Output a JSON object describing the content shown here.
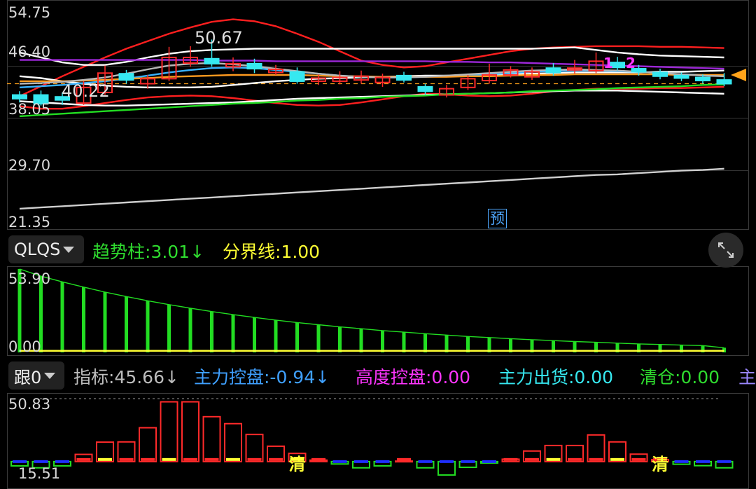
{
  "main_chart": {
    "price_labels": [
      "54.75",
      "46.40",
      "38.05",
      "29.70",
      "21.35"
    ],
    "annotations": {
      "high": "50.67",
      "low": "40.22",
      "markers": [
        "1",
        "2"
      ]
    },
    "predict_badge": "预"
  },
  "qlqs_panel": {
    "selector": "QLQS",
    "trend_label": "趋势柱:3.01↓",
    "boundary_label": "分界线:1.00",
    "y_top": "53.90",
    "y_bottom": "0.00"
  },
  "gen_panel": {
    "selector": "跟0",
    "items": [
      {
        "text": "指标:45.66↓",
        "color": "#bdbdbd"
      },
      {
        "text": "主力控盘:-0.94↓",
        "color": "#3fa0ff"
      },
      {
        "text": "高度控盘:0.00",
        "color": "#ff35ff"
      },
      {
        "text": "主力出货:0.00",
        "color": "#36e8f0"
      },
      {
        "text": "清仓:0.00",
        "color": "#2fdd2f"
      },
      {
        "text": "主",
        "color": "#9a86ff"
      }
    ],
    "y_top": "50.83",
    "y_bottom": "15.51",
    "clear_marker": "清"
  },
  "chart_data": [
    {
      "type": "candlestick",
      "ylim": [
        21.35,
        54.75
      ],
      "yticks": [
        54.75,
        46.4,
        38.05,
        29.7,
        21.35
      ],
      "candles": [
        {
          "o": 41.8,
          "c": 41.2,
          "h": 42.4,
          "l": 40.6,
          "color": "cyan"
        },
        {
          "o": 40.4,
          "c": 41.8,
          "h": 42.5,
          "l": 40.1,
          "color": "cyan"
        },
        {
          "o": 41.0,
          "c": 41.5,
          "h": 42.2,
          "l": 40.2,
          "color": "cyan"
        },
        {
          "o": 40.5,
          "c": 43.0,
          "h": 44.0,
          "l": 40.2,
          "color": "red"
        },
        {
          "o": 42.2,
          "c": 45.3,
          "h": 46.5,
          "l": 41.8,
          "color": "red"
        },
        {
          "o": 45.2,
          "c": 44.2,
          "h": 45.8,
          "l": 43.6,
          "color": "cyan"
        },
        {
          "o": 43.6,
          "c": 44.4,
          "h": 45.0,
          "l": 42.8,
          "color": "red"
        },
        {
          "o": 44.4,
          "c": 47.8,
          "h": 49.5,
          "l": 44.0,
          "color": "red"
        },
        {
          "o": 46.9,
          "c": 47.8,
          "h": 49.6,
          "l": 46.3,
          "color": "red"
        },
        {
          "o": 47.6,
          "c": 46.8,
          "h": 50.67,
          "l": 46.3,
          "color": "cyan"
        },
        {
          "o": 46.3,
          "c": 46.8,
          "h": 47.8,
          "l": 45.6,
          "color": "red"
        },
        {
          "o": 46.8,
          "c": 46.0,
          "h": 47.6,
          "l": 45.3,
          "color": "cyan"
        },
        {
          "o": 45.9,
          "c": 45.4,
          "h": 46.6,
          "l": 45.0,
          "color": "red"
        },
        {
          "o": 45.5,
          "c": 44.0,
          "h": 46.2,
          "l": 43.6,
          "color": "cyan"
        },
        {
          "o": 44.0,
          "c": 44.5,
          "h": 45.1,
          "l": 43.4,
          "color": "red"
        },
        {
          "o": 44.6,
          "c": 44.0,
          "h": 45.6,
          "l": 43.5,
          "color": "red"
        },
        {
          "o": 44.2,
          "c": 44.8,
          "h": 45.7,
          "l": 43.6,
          "color": "red"
        },
        {
          "o": 43.8,
          "c": 44.6,
          "h": 45.2,
          "l": 43.1,
          "color": "red"
        },
        {
          "o": 44.9,
          "c": 44.2,
          "h": 45.5,
          "l": 43.8,
          "color": "cyan"
        },
        {
          "o": 43.1,
          "c": 42.4,
          "h": 43.6,
          "l": 41.8,
          "color": "cyan"
        },
        {
          "o": 41.8,
          "c": 42.8,
          "h": 43.4,
          "l": 41.4,
          "color": "red"
        },
        {
          "o": 43.0,
          "c": 44.4,
          "h": 45.0,
          "l": 42.6,
          "color": "red"
        },
        {
          "o": 44.1,
          "c": 45.0,
          "h": 46.8,
          "l": 43.6,
          "color": "red"
        },
        {
          "o": 45.0,
          "c": 45.8,
          "h": 46.4,
          "l": 44.6,
          "color": "red"
        },
        {
          "o": 44.7,
          "c": 45.5,
          "h": 46.2,
          "l": 44.2,
          "color": "red"
        },
        {
          "o": 45.4,
          "c": 46.1,
          "h": 46.9,
          "l": 44.9,
          "color": "cyan"
        },
        {
          "o": 45.8,
          "c": 46.1,
          "h": 47.4,
          "l": 45.2,
          "color": "red"
        },
        {
          "o": 45.7,
          "c": 47.2,
          "h": 48.6,
          "l": 45.3,
          "color": "red"
        },
        {
          "o": 47.0,
          "c": 46.2,
          "h": 47.9,
          "l": 45.7,
          "color": "cyan"
        },
        {
          "o": 46.0,
          "c": 45.5,
          "h": 46.6,
          "l": 44.9,
          "color": "cyan"
        },
        {
          "o": 45.4,
          "c": 44.8,
          "h": 46.0,
          "l": 44.3,
          "color": "cyan"
        },
        {
          "o": 44.9,
          "c": 44.5,
          "h": 45.4,
          "l": 44.0,
          "color": "cyan"
        },
        {
          "o": 44.6,
          "c": 44.1,
          "h": 45.1,
          "l": 43.6,
          "color": "cyan"
        },
        {
          "o": 44.2,
          "c": 43.6,
          "h": 45.3,
          "l": 43.2,
          "color": "cyan"
        }
      ],
      "lines": [
        {
          "name": "",
          "color": "#ff1f1f",
          "values": [
            41.6,
            43.2,
            44.8,
            46.3,
            47.8,
            49.2,
            50.4,
            51.6,
            52.6,
            53.5,
            53.9,
            53.6,
            52.8,
            51.6,
            50.3,
            48.8,
            47.3,
            46.6,
            46.2,
            46.4,
            47.0,
            47.6,
            48.2,
            48.8,
            49.2,
            49.4,
            49.5,
            49.6,
            49.6,
            49.6,
            49.5,
            49.5,
            49.4,
            49.3
          ]
        },
        {
          "name": "",
          "color": "#ff1f1f",
          "values": [
            40.0,
            39.6,
            39.6,
            40.0,
            40.5,
            41.0,
            41.4,
            41.6,
            41.7,
            41.6,
            41.3,
            40.9,
            40.5,
            40.2,
            40.1,
            40.2,
            40.6,
            41.1,
            41.6,
            42.0,
            41.9,
            41.7,
            41.6,
            41.7,
            42.0,
            42.4,
            42.6,
            42.8,
            42.8,
            42.8,
            42.9,
            42.9,
            43.0,
            43.1
          ]
        },
        {
          "name": "",
          "color": "#ffffff",
          "values": [
            48.6,
            47.8,
            47.0,
            46.6,
            46.6,
            47.1,
            47.8,
            48.4,
            48.8,
            49.0,
            49.1,
            49.2,
            49.2,
            49.2,
            49.2,
            49.2,
            49.2,
            49.2,
            49.2,
            49.2,
            49.2,
            49.2,
            49.2,
            49.2,
            49.2,
            49.3,
            49.4,
            49.0,
            48.6,
            48.3,
            48.1,
            48.0,
            47.9,
            47.8
          ]
        },
        {
          "name": "",
          "color": "#ffffff",
          "values": [
            44.8,
            44.5,
            44.0,
            43.6,
            43.3,
            43.1,
            43.0,
            43.0,
            43.0,
            43.1,
            43.4,
            43.7,
            44.0,
            44.2,
            44.4,
            44.5,
            44.6,
            44.7,
            44.8,
            44.9,
            44.9,
            44.9,
            45.0,
            45.1,
            45.2,
            45.3,
            45.4,
            45.4,
            45.4,
            45.4,
            45.5,
            45.5,
            45.6,
            45.7
          ]
        },
        {
          "name": "",
          "color": "#ffffff",
          "values": [
            40.8,
            40.6,
            40.4,
            40.2,
            40.1,
            40.1,
            40.2,
            40.3,
            40.4,
            40.5,
            40.6,
            40.8,
            41.0,
            41.2,
            41.3,
            41.4,
            41.5,
            41.6,
            41.7,
            41.8,
            41.9,
            42.0,
            42.1,
            42.2,
            42.3,
            42.4,
            42.5,
            42.5,
            42.5,
            42.4,
            42.3,
            42.2,
            42.1,
            42.0
          ]
        },
        {
          "name": "",
          "color": "#9c27d8",
          "values": [
            47.4,
            47.4,
            47.4,
            47.4,
            47.4,
            47.4,
            47.4,
            47.4,
            47.4,
            47.3,
            47.3,
            47.3,
            47.2,
            47.2,
            47.2,
            47.2,
            47.2,
            47.2,
            47.2,
            47.2,
            47.1,
            47.1,
            47.0,
            47.0,
            46.9,
            46.8,
            46.7,
            46.6,
            46.5,
            46.4,
            46.3,
            46.2,
            46.1,
            46.0
          ]
        },
        {
          "name": "",
          "color": "#39b3ff",
          "values": [
            43.0,
            43.2,
            43.4,
            43.7,
            44.0,
            44.4,
            44.9,
            45.4,
            45.8,
            46.1,
            46.2,
            46.1,
            45.8,
            45.5,
            45.2,
            44.9,
            44.7,
            44.6,
            44.6,
            44.7,
            44.8,
            44.9,
            45.1,
            45.3,
            45.5,
            45.6,
            45.7,
            45.7,
            45.6,
            45.5,
            45.3,
            45.1,
            45.0,
            44.8
          ]
        },
        {
          "name": "",
          "color": "#ff9a1f",
          "values": [
            44.0,
            44.0,
            44.0,
            44.1,
            44.2,
            44.4,
            44.5,
            44.7,
            44.8,
            44.9,
            45.0,
            45.0,
            45.0,
            45.0,
            44.9,
            44.8,
            44.8,
            44.7,
            44.7,
            44.7,
            44.7,
            44.8,
            44.8,
            44.9,
            45.0,
            45.0,
            45.1,
            45.1,
            45.1,
            45.1,
            45.1,
            45.0,
            45.0,
            45.0
          ]
        },
        {
          "name": "",
          "color": "#b8b8b8",
          "values": [
            43.6,
            43.7,
            43.9,
            44.2,
            44.6,
            45.2,
            45.9,
            46.5,
            46.8,
            46.9,
            46.7,
            46.4,
            46.0,
            45.6,
            45.2,
            44.9,
            44.7,
            44.6,
            44.6,
            44.7,
            44.9,
            45.1,
            45.3,
            45.5,
            45.7,
            45.8,
            45.9,
            45.8,
            45.7,
            45.5,
            45.3,
            45.1,
            44.9,
            44.8
          ]
        },
        {
          "name": "",
          "color": "#22dd22",
          "values": [
            38.4,
            38.6,
            38.8,
            39.0,
            39.2,
            39.4,
            39.6,
            39.8,
            40.0,
            40.2,
            40.4,
            40.5,
            40.7,
            40.9,
            41.0,
            41.2,
            41.3,
            41.5,
            41.6,
            41.7,
            41.9,
            42.0,
            42.1,
            42.2,
            42.4,
            42.5,
            42.6,
            42.7,
            42.9,
            43.0,
            43.1,
            43.2,
            43.4,
            43.5
          ]
        },
        {
          "name": "",
          "color": "#cfcfcf",
          "values": [
            23.6,
            23.8,
            24.0,
            24.2,
            24.4,
            24.6,
            24.8,
            25.0,
            25.2,
            25.4,
            25.6,
            25.8,
            26.0,
            26.2,
            26.4,
            26.6,
            26.8,
            27.0,
            27.2,
            27.4,
            27.6,
            27.8,
            28.0,
            28.2,
            28.4,
            28.6,
            28.8,
            29.0,
            29.1,
            29.3,
            29.5,
            29.7,
            29.8,
            30.0
          ]
        }
      ]
    },
    {
      "type": "bar",
      "ylim": [
        0,
        53.9
      ],
      "series": [
        {
          "name": "趋势柱",
          "color": "#22dd22",
          "values": [
            53.9,
            49.3,
            45.6,
            42.2,
            39.0,
            36.1,
            33.4,
            30.9,
            28.6,
            26.4,
            24.4,
            22.6,
            20.9,
            19.3,
            17.9,
            16.5,
            15.3,
            14.1,
            13.1,
            12.1,
            11.2,
            10.3,
            9.6,
            8.9,
            8.2,
            7.6,
            7.0,
            6.5,
            6.0,
            5.5,
            5.1,
            4.7,
            4.4,
            3.01
          ]
        },
        {
          "name": "分界线",
          "color": "#ffff33",
          "values": [
            1.0,
            1.0,
            1.0,
            1.0,
            1.0,
            1.0,
            1.0,
            1.0,
            1.0,
            1.0,
            1.0,
            1.0,
            1.0,
            1.0,
            1.0,
            1.0,
            1.0,
            1.0,
            1.0,
            1.0,
            1.0,
            1.0,
            1.0,
            1.0,
            1.0,
            1.0,
            1.0,
            1.0,
            1.0,
            1.0,
            1.0,
            1.0,
            1.0,
            1.0
          ]
        }
      ]
    },
    {
      "type": "bar",
      "ylim": [
        15.51,
        50.83
      ],
      "baseline": 24.6,
      "series": [
        {
          "name": "指标",
          "values": [
            22.8,
            22.0,
            22.8,
            27.6,
            32.7,
            32.8,
            38.7,
            49.5,
            49.5,
            43.3,
            40.4,
            35.9,
            31.0,
            28.0,
            25.2,
            23.6,
            22.0,
            22.8,
            24.8,
            22.0,
            19.0,
            22.2,
            24.0,
            25.6,
            29.0,
            31.3,
            31.3,
            35.7,
            32.8,
            27.7,
            25.4,
            23.5,
            22.9,
            22.0
          ]
        },
        {
          "name": "清",
          "values": [
            0,
            0,
            0,
            0,
            0,
            0,
            0,
            0,
            0,
            0,
            0,
            0,
            0,
            1,
            0,
            0,
            0,
            0,
            0,
            0,
            0,
            0,
            0,
            0,
            0,
            0,
            0,
            0,
            0,
            0,
            1,
            0,
            0,
            0
          ]
        }
      ]
    }
  ]
}
